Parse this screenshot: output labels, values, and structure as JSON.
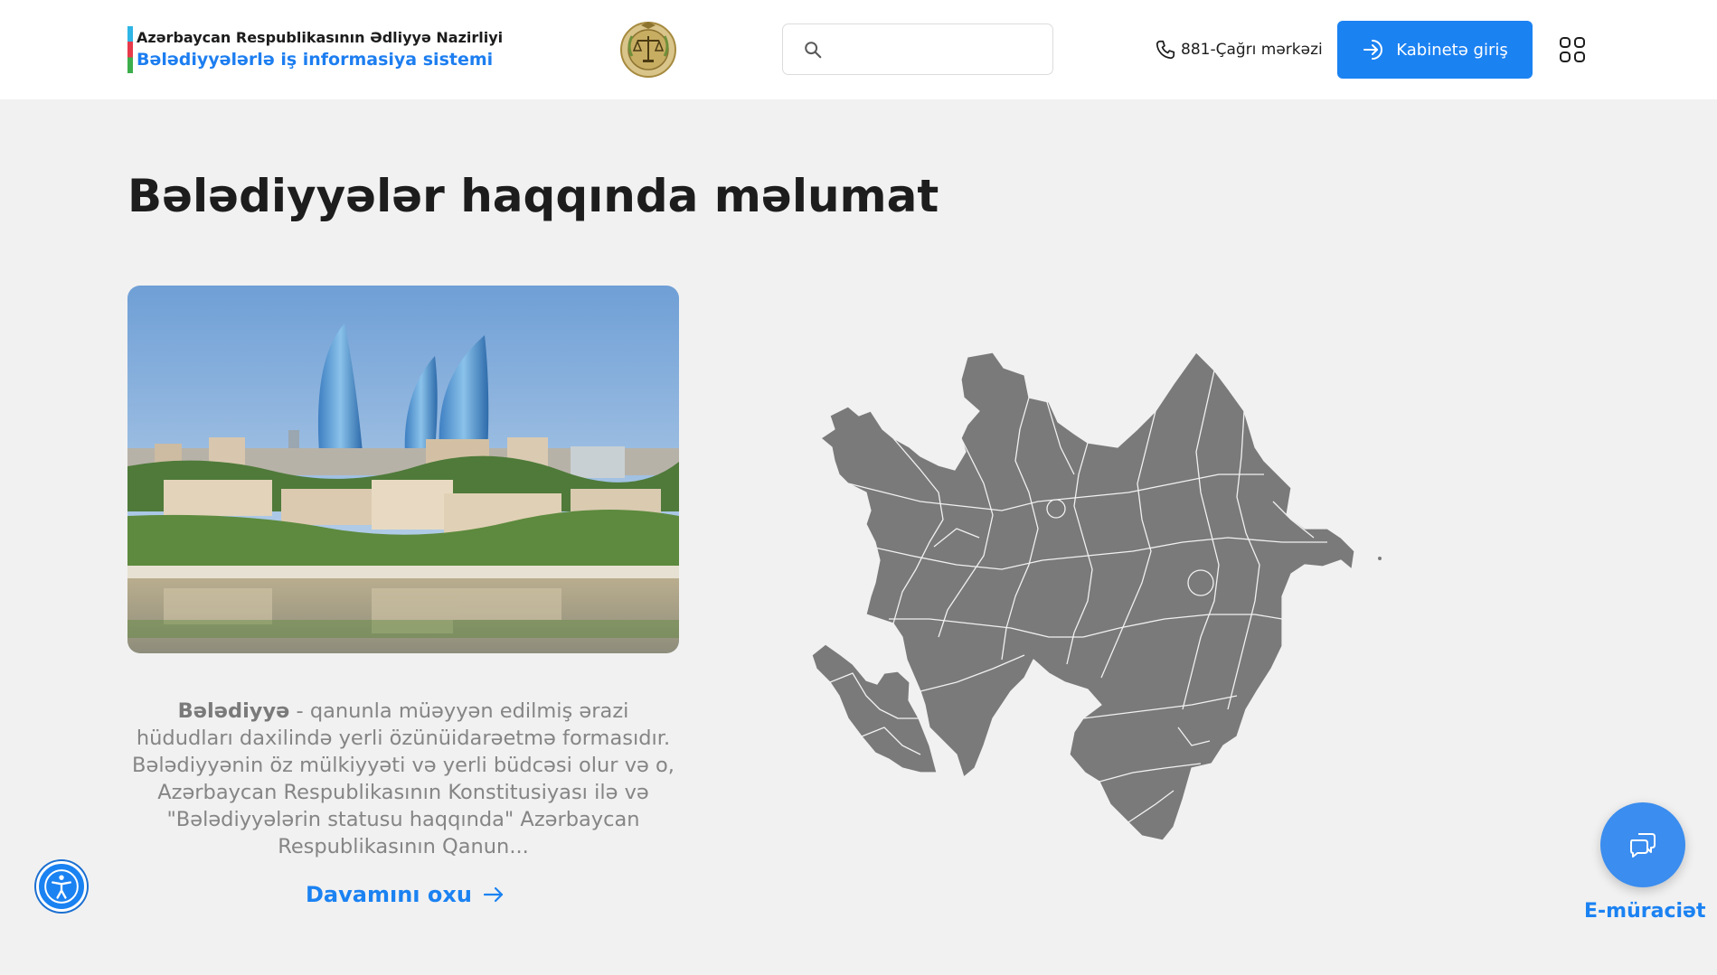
{
  "header": {
    "ministry": "Azərbaycan Respublikasının Ədliyyə Nazirliyi",
    "system_name": "Bələdiyyələrlə iş informasiya sistemi",
    "search_placeholder": "",
    "call_center": "881-Çağrı mərkəzi",
    "login_label": "Kabinetə giriş"
  },
  "main": {
    "title": "Bələdiyyələr haqqında məlumat",
    "description_term": "Bələdiyyə",
    "description_text": " - qanunla müəyyən edilmiş ərazi hüdudları daxilində yerli özünüidarəetmə formasıdır. Bələdiyyənin öz mülkiyyəti və yerli büdcəsi olur və o, Azərbaycan Respublikasının Konstitusiyası ilə və \"Bələdiyyələrin statusu haqqında\" Azərbaycan Respublikasının Qanun...",
    "read_more": "Davamını oxu"
  },
  "chat": {
    "label": "E-müraciət"
  },
  "colors": {
    "accent": "#1b82f2",
    "map_fill": "#7a7a7a",
    "background": "#f1f1f1"
  },
  "icons": {
    "search": "search-icon",
    "phone": "phone-icon",
    "login": "login-icon",
    "apps": "apps-grid-icon",
    "arrow": "arrow-right-icon",
    "accessibility": "accessibility-icon",
    "chat": "chat-bubbles-icon"
  }
}
